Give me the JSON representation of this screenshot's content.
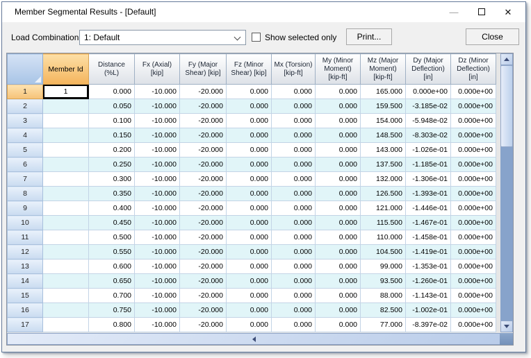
{
  "window": {
    "title": "Member Segmental Results - [Default]",
    "buttons": {
      "minimize_glyph": "—",
      "close_glyph": "✕"
    }
  },
  "toolbar": {
    "load_combination_label": "Load Combination:",
    "load_combination_value": "1: Default",
    "show_selected_only_label": "Show selected only",
    "show_selected_only_checked": false,
    "print_label": "Print...",
    "close_label": "Close"
  },
  "colors": {
    "member_header_orange": "#f4b45c",
    "row_header_blue": "#c9dbf0",
    "alt_row_cyan": "#e1f5f8",
    "scroll_track_blue": "#87a3cb",
    "dialog_background": "#f0f0f0"
  },
  "grid": {
    "corner_label": "",
    "columns": [
      "Member Id",
      "Distance (%L)",
      "Fx (Axial) [kip]",
      "Fy (Major Shear) [kip]",
      "Fz (Minor Shear) [kip]",
      "Mx (Torsion) [kip-ft]",
      "My (Minor Moment) [kip-ft]",
      "Mz (Major Moment) [kip-ft]",
      "Dy (Major Deflection) [in]",
      "Dz (Minor Deflection) [in]"
    ],
    "active_cell": {
      "row_index": 0,
      "column": "Member Id"
    },
    "rows": [
      [
        "1",
        "1",
        "0.000",
        "-10.000",
        "-20.000",
        "0.000",
        "0.000",
        "0.000",
        "165.000",
        "0.000e+00",
        "0.000e+00"
      ],
      [
        "2",
        "",
        "0.050",
        "-10.000",
        "-20.000",
        "0.000",
        "0.000",
        "0.000",
        "159.500",
        "-3.185e-02",
        "0.000e+00"
      ],
      [
        "3",
        "",
        "0.100",
        "-10.000",
        "-20.000",
        "0.000",
        "0.000",
        "0.000",
        "154.000",
        "-5.948e-02",
        "0.000e+00"
      ],
      [
        "4",
        "",
        "0.150",
        "-10.000",
        "-20.000",
        "0.000",
        "0.000",
        "0.000",
        "148.500",
        "-8.303e-02",
        "0.000e+00"
      ],
      [
        "5",
        "",
        "0.200",
        "-10.000",
        "-20.000",
        "0.000",
        "0.000",
        "0.000",
        "143.000",
        "-1.026e-01",
        "0.000e+00"
      ],
      [
        "6",
        "",
        "0.250",
        "-10.000",
        "-20.000",
        "0.000",
        "0.000",
        "0.000",
        "137.500",
        "-1.185e-01",
        "0.000e+00"
      ],
      [
        "7",
        "",
        "0.300",
        "-10.000",
        "-20.000",
        "0.000",
        "0.000",
        "0.000",
        "132.000",
        "-1.306e-01",
        "0.000e+00"
      ],
      [
        "8",
        "",
        "0.350",
        "-10.000",
        "-20.000",
        "0.000",
        "0.000",
        "0.000",
        "126.500",
        "-1.393e-01",
        "0.000e+00"
      ],
      [
        "9",
        "",
        "0.400",
        "-10.000",
        "-20.000",
        "0.000",
        "0.000",
        "0.000",
        "121.000",
        "-1.446e-01",
        "0.000e+00"
      ],
      [
        "10",
        "",
        "0.450",
        "-10.000",
        "-20.000",
        "0.000",
        "0.000",
        "0.000",
        "115.500",
        "-1.467e-01",
        "0.000e+00"
      ],
      [
        "11",
        "",
        "0.500",
        "-10.000",
        "-20.000",
        "0.000",
        "0.000",
        "0.000",
        "110.000",
        "-1.458e-01",
        "0.000e+00"
      ],
      [
        "12",
        "",
        "0.550",
        "-10.000",
        "-20.000",
        "0.000",
        "0.000",
        "0.000",
        "104.500",
        "-1.419e-01",
        "0.000e+00"
      ],
      [
        "13",
        "",
        "0.600",
        "-10.000",
        "-20.000",
        "0.000",
        "0.000",
        "0.000",
        "99.000",
        "-1.353e-01",
        "0.000e+00"
      ],
      [
        "14",
        "",
        "0.650",
        "-10.000",
        "-20.000",
        "0.000",
        "0.000",
        "0.000",
        "93.500",
        "-1.260e-01",
        "0.000e+00"
      ],
      [
        "15",
        "",
        "0.700",
        "-10.000",
        "-20.000",
        "0.000",
        "0.000",
        "0.000",
        "88.000",
        "-1.143e-01",
        "0.000e+00"
      ],
      [
        "16",
        "",
        "0.750",
        "-10.000",
        "-20.000",
        "0.000",
        "0.000",
        "0.000",
        "82.500",
        "-1.002e-01",
        "0.000e+00"
      ],
      [
        "17",
        "",
        "0.800",
        "-10.000",
        "-20.000",
        "0.000",
        "0.000",
        "0.000",
        "77.000",
        "-8.397e-02",
        "0.000e+00"
      ]
    ]
  }
}
